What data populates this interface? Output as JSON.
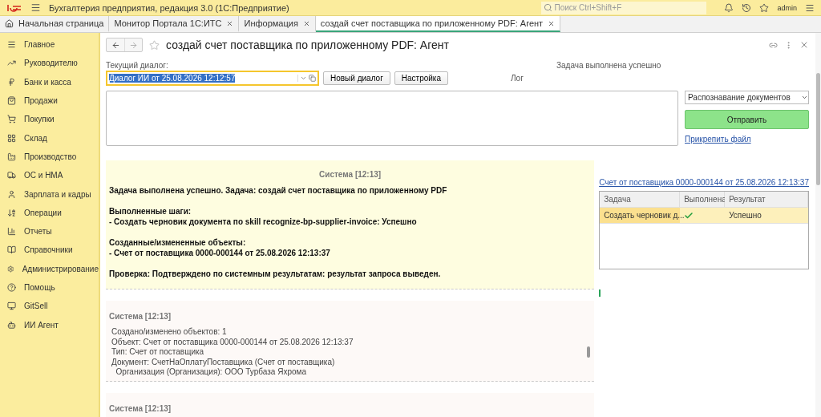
{
  "app_bar": {
    "title": "Бухгалтерия предприятия, редакция 3.0  (1С:Предприятие)",
    "search": {
      "placeholder": "Поиск Ctrl+Shift+F"
    },
    "user": "admin"
  },
  "tabs": [
    {
      "label": "Начальная страница",
      "selected": false,
      "closable": false
    },
    {
      "label": "Монитор Портала 1С:ИТС",
      "selected": false,
      "closable": true
    },
    {
      "label": "Информация",
      "selected": false,
      "closable": true
    },
    {
      "label": "создай счет поставщика по приложенному PDF: Агент",
      "selected": true,
      "closable": true
    }
  ],
  "sidebar": {
    "items": [
      {
        "label": "Главное"
      },
      {
        "label": "Руководителю"
      },
      {
        "label": "Банк и касса"
      },
      {
        "label": "Продажи"
      },
      {
        "label": "Покупки"
      },
      {
        "label": "Склад"
      },
      {
        "label": "Производство"
      },
      {
        "label": "ОС и НМА"
      },
      {
        "label": "Зарплата и кадры"
      },
      {
        "label": "Операции"
      },
      {
        "label": "Отчеты"
      },
      {
        "label": "Справочники"
      },
      {
        "label": "Администрирование"
      },
      {
        "label": "Помощь"
      },
      {
        "label": "GitSell"
      },
      {
        "label": "ИИ Агент"
      }
    ]
  },
  "form": {
    "title": "создай счет поставщика по приложенному PDF: Агент",
    "dialog_label": "Текущий диалог:",
    "status": "Задача выполнена успешно",
    "dialog_value": "Диалог ИИ от 25.08.2026 12:12:57",
    "buttons": [
      "Новый диалог",
      "Настройка"
    ],
    "log_label": "Лог",
    "mode_value": "Распознавание документов",
    "send_button": "Отправить",
    "attach_link": "Прикрепить файл",
    "messages": [
      {
        "kind": "summary",
        "header": "Система [12:13]",
        "paragraphs": [
          [
            "Задача выполнена успешно. Задача: создай счет поставщика по приложенному PDF"
          ],
          [
            "Выполненные шаги:",
            "- Создать черновик документа по skill recognize-bp-supplier-invoice: Успешно"
          ],
          [
            "Созданные/измененные объекты:",
            "- Счет от поставщика 0000-000144 от 25.08.2026 12:13:37"
          ],
          [
            "Проверка: Подтверждено по системным результатам: результат запроса выведен."
          ]
        ]
      },
      {
        "kind": "log",
        "header": "Система [12:13]",
        "lines": [
          "Создано/изменено объектов: 1",
          "Объект: Счет от поставщика 0000-000144 от 25.08.2026 12:13:37",
          "Тип: Счет от поставщика",
          "Документ: СчетНаОплатуПоставщика (Счет от поставщика)",
          "  Организация (Организация): ООО Турбаза Яхрома"
        ]
      },
      {
        "kind": "log",
        "header": "Система [12:13]"
      }
    ],
    "object_link": "Счет от поставщика 0000-000144 от 25.08.2026 12:13:37",
    "table": {
      "columns": [
        "Задача",
        "Выполнена",
        "Результат"
      ],
      "rows": [
        {
          "task": "Создать черновик д...",
          "done": true,
          "result": "Успешно",
          "selected": true
        }
      ]
    }
  }
}
